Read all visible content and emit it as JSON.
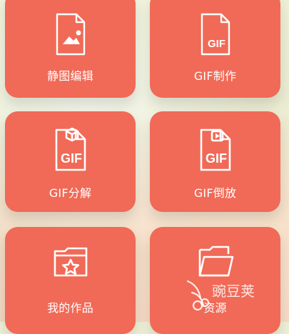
{
  "tiles": [
    {
      "label": "静图编辑",
      "icon": "image-file-icon"
    },
    {
      "label": "GIF制作",
      "icon": "gif-file-icon"
    },
    {
      "label": "GIF分解",
      "icon": "gif-box-file-icon"
    },
    {
      "label": "GIF倒放",
      "icon": "gif-reverse-file-icon"
    },
    {
      "label": "我的作品",
      "icon": "star-folder-icon"
    },
    {
      "label": "资源",
      "icon": "folder-icon"
    }
  ],
  "watermark": {
    "text": "豌豆荚"
  },
  "colors": {
    "tile": "#f06a57",
    "icon_stroke": "#ffffff",
    "text": "#ffffff"
  }
}
